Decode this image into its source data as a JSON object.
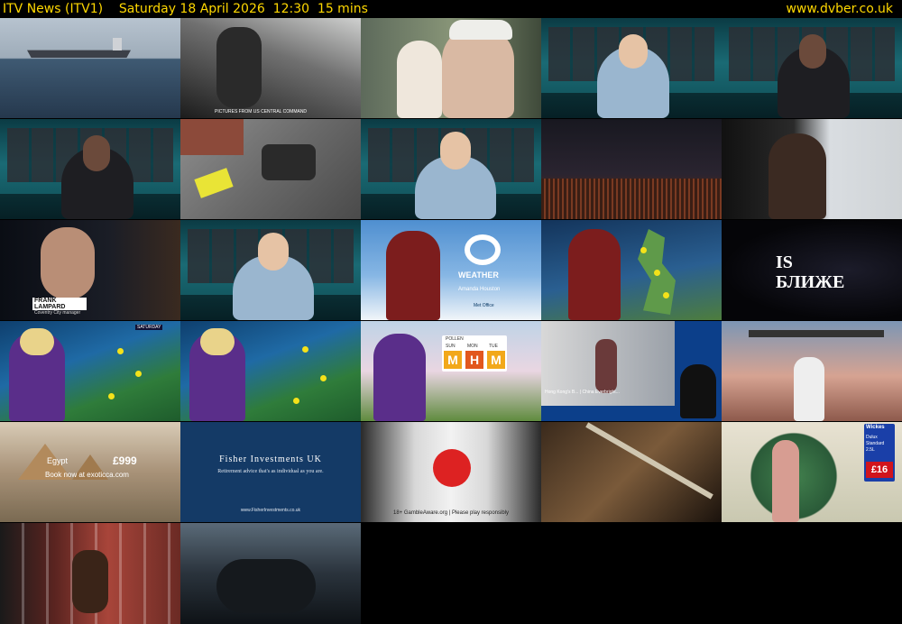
{
  "header": {
    "channel": "ITV News (ITV1)",
    "datetime": "Saturday 18 April 2026  12:30  15 mins",
    "site": "www.dvber.co.uk"
  },
  "colors": {
    "header_text": "#ffd800",
    "background": "#000000"
  },
  "captions": {
    "cctv": "PICTURES FROM US CENTRAL COMMAND",
    "lampard_name": "FRANK LAMPARD",
    "lampard_role": "Coventry City manager",
    "weather_logo": "WEATHER",
    "weather_presenter": "Amanda Houston",
    "met_office": "Met Office",
    "ad_text": "IS\nБЛИЖЕ",
    "pollen_title": "POLLEN",
    "pollen_days": [
      "SUN",
      "MON",
      "TUE"
    ],
    "pollen_levels": [
      "M",
      "H",
      "M"
    ],
    "map_label": "SATURDAY",
    "egypt_label": "Egypt",
    "egypt_price": "£999",
    "egypt_url": "Book now at exoticca.com",
    "fisher_title": "Fisher Investments UK",
    "fisher_tagline": "Retirement advice that's as individual as you are.",
    "fisher_url": "www.FisherInvestments.co.uk",
    "gamble": "18+ GambleAware.org | Please play responsibly",
    "wine_brand": "Wickes",
    "wine_label1": "Dulux",
    "wine_label2": "Standard",
    "wine_label3": "2.5L",
    "wine_price": "£16",
    "signer_caption": "Hong Kong's B... | China Everbright..."
  }
}
